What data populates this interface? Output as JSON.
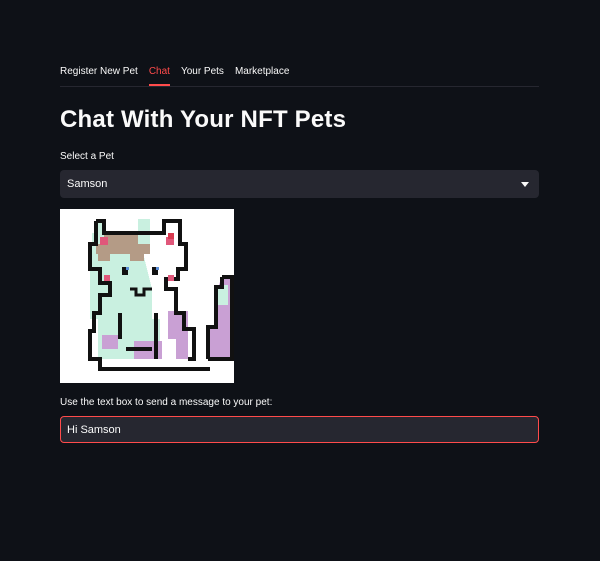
{
  "tabs": [
    {
      "label": "Register New Pet",
      "active": false
    },
    {
      "label": "Chat",
      "active": true
    },
    {
      "label": "Your Pets",
      "active": false
    },
    {
      "label": "Marketplace",
      "active": false
    }
  ],
  "page": {
    "title": "Chat With Your NFT Pets"
  },
  "pet_select": {
    "label": "Select a Pet",
    "value": "Samson",
    "icon": "chevron-down-icon"
  },
  "pet_image": {
    "icon": "pixel-cat-image"
  },
  "message": {
    "label": "Use the text box to send a message to your pet:",
    "value": "Hi Samson"
  },
  "colors": {
    "accent": "#ff4b4b",
    "background": "#0e1117",
    "field": "#262730",
    "text": "#fafafa"
  }
}
